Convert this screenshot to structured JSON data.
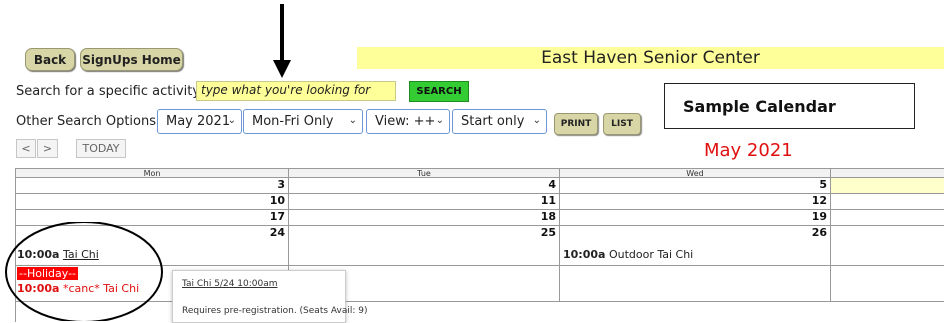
{
  "topbar": {
    "back_label": "Back",
    "signups_home_label": "SignUps Home",
    "center_name": "East Haven Senior Center"
  },
  "search": {
    "label": "Search for a specific activity:",
    "placeholder": "type what you're looking for",
    "button_label": "SEARCH"
  },
  "options": {
    "label": "Other Search Options:",
    "month_value": "May 2021",
    "days_value": "Mon-Fri Only",
    "view_value": "View: ++",
    "time_value": "Start only",
    "print_label": "PRINT",
    "list_label": "LIST"
  },
  "nav": {
    "prev": "<",
    "next": ">",
    "today": "TODAY"
  },
  "annotation": {
    "sample_label": "Sample Calendar"
  },
  "calendar": {
    "month_title": "May 2021",
    "headers": [
      "Mon",
      "Tue",
      "Wed"
    ],
    "weeks": [
      [
        "3",
        "4",
        "5"
      ],
      [
        "10",
        "11",
        "12"
      ],
      [
        "17",
        "18",
        "19"
      ],
      [
        "24",
        "25",
        "26"
      ]
    ],
    "events": {
      "mon_24_time": "10:00a",
      "mon_24_title": "Tai Chi",
      "holiday": "--Holiday--",
      "canc_time": "10:00a",
      "canc_title": "*canc* Tai Chi",
      "wed_26_time": "10:00a",
      "wed_26_title": "Outdoor Tai Chi"
    }
  },
  "popup": {
    "title": "Tai Chi  5/24 10:00am",
    "body": "Requires pre-registration. (Seats Avail: 9)"
  },
  "colors": {
    "banner": "#ffff99",
    "search_button": "#33cc33",
    "month_title": "#e01010",
    "holiday_bg": "#ff0000",
    "canceled_text": "#e01010"
  }
}
